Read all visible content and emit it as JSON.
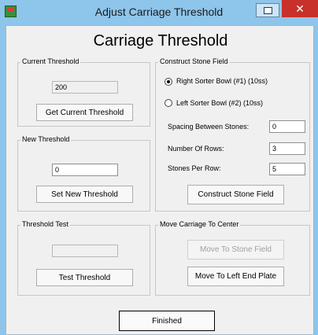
{
  "window": {
    "title": "Adjust Carriage Threshold",
    "close_glyph": "✕",
    "heading": "Carriage Threshold"
  },
  "current_threshold": {
    "legend": "Current Threshold",
    "value": "200",
    "button": "Get Current Threshold"
  },
  "new_threshold": {
    "legend": "New Threshold",
    "value": "0",
    "button": "Set New Threshold"
  },
  "threshold_test": {
    "legend": "Threshold Test",
    "value": "",
    "button": "Test Threshold"
  },
  "construct": {
    "legend": "Construct Stone Field",
    "radio_right": "Right Sorter Bowl (#1) (10ss)",
    "radio_left": "Left Sorter Bowl (#2) (10ss)",
    "selected": "right",
    "spacing_label": "Spacing Between Stones:",
    "spacing_value": "0",
    "rows_label": "Number Of Rows:",
    "rows_value": "3",
    "per_row_label": "Stones Per Row:",
    "per_row_value": "5",
    "button": "Construct Stone Field"
  },
  "move": {
    "legend": "Move Carriage To Center",
    "to_field_button": "Move To Stone Field",
    "to_left_button": "Move To Left End Plate"
  },
  "finished_button": "Finished"
}
